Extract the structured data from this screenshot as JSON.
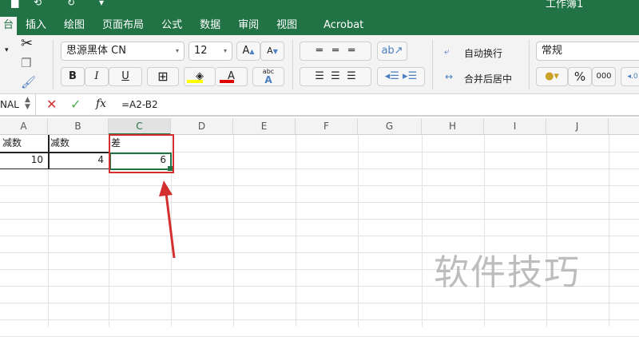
{
  "window": {
    "title": "工作簿1"
  },
  "tabs": [
    "台",
    "插入",
    "绘图",
    "页面布局",
    "公式",
    "数据",
    "审阅",
    "视图",
    "Acrobat"
  ],
  "ribbon": {
    "font_name": "思源黑体 CN",
    "font_size": "12",
    "wrap_text": "自动换行",
    "merge_center": "合并后居中",
    "number_format": "常规",
    "percent": "%",
    "thousands": "000",
    "bold": "B",
    "italic": "I",
    "underline": "U",
    "grow": "A",
    "shrink": "A",
    "font_color": "A",
    "abc": "abc",
    "highlight_color": "#ffff00",
    "font_color_value": "#e00000"
  },
  "formula_bar": {
    "name_box": "NAL",
    "formula": "=A2-B2",
    "fx": "fx"
  },
  "columns": [
    "A",
    "B",
    "C",
    "D",
    "E",
    "F",
    "G",
    "H",
    "I",
    "J"
  ],
  "cells": {
    "A1": "减数",
    "B1": "减数",
    "C1": "差",
    "A2": "10",
    "B2": "4",
    "C2": "6"
  },
  "watermark": "软件技巧",
  "colors": {
    "accent": "#217346",
    "annotation": "#d32f2f"
  }
}
